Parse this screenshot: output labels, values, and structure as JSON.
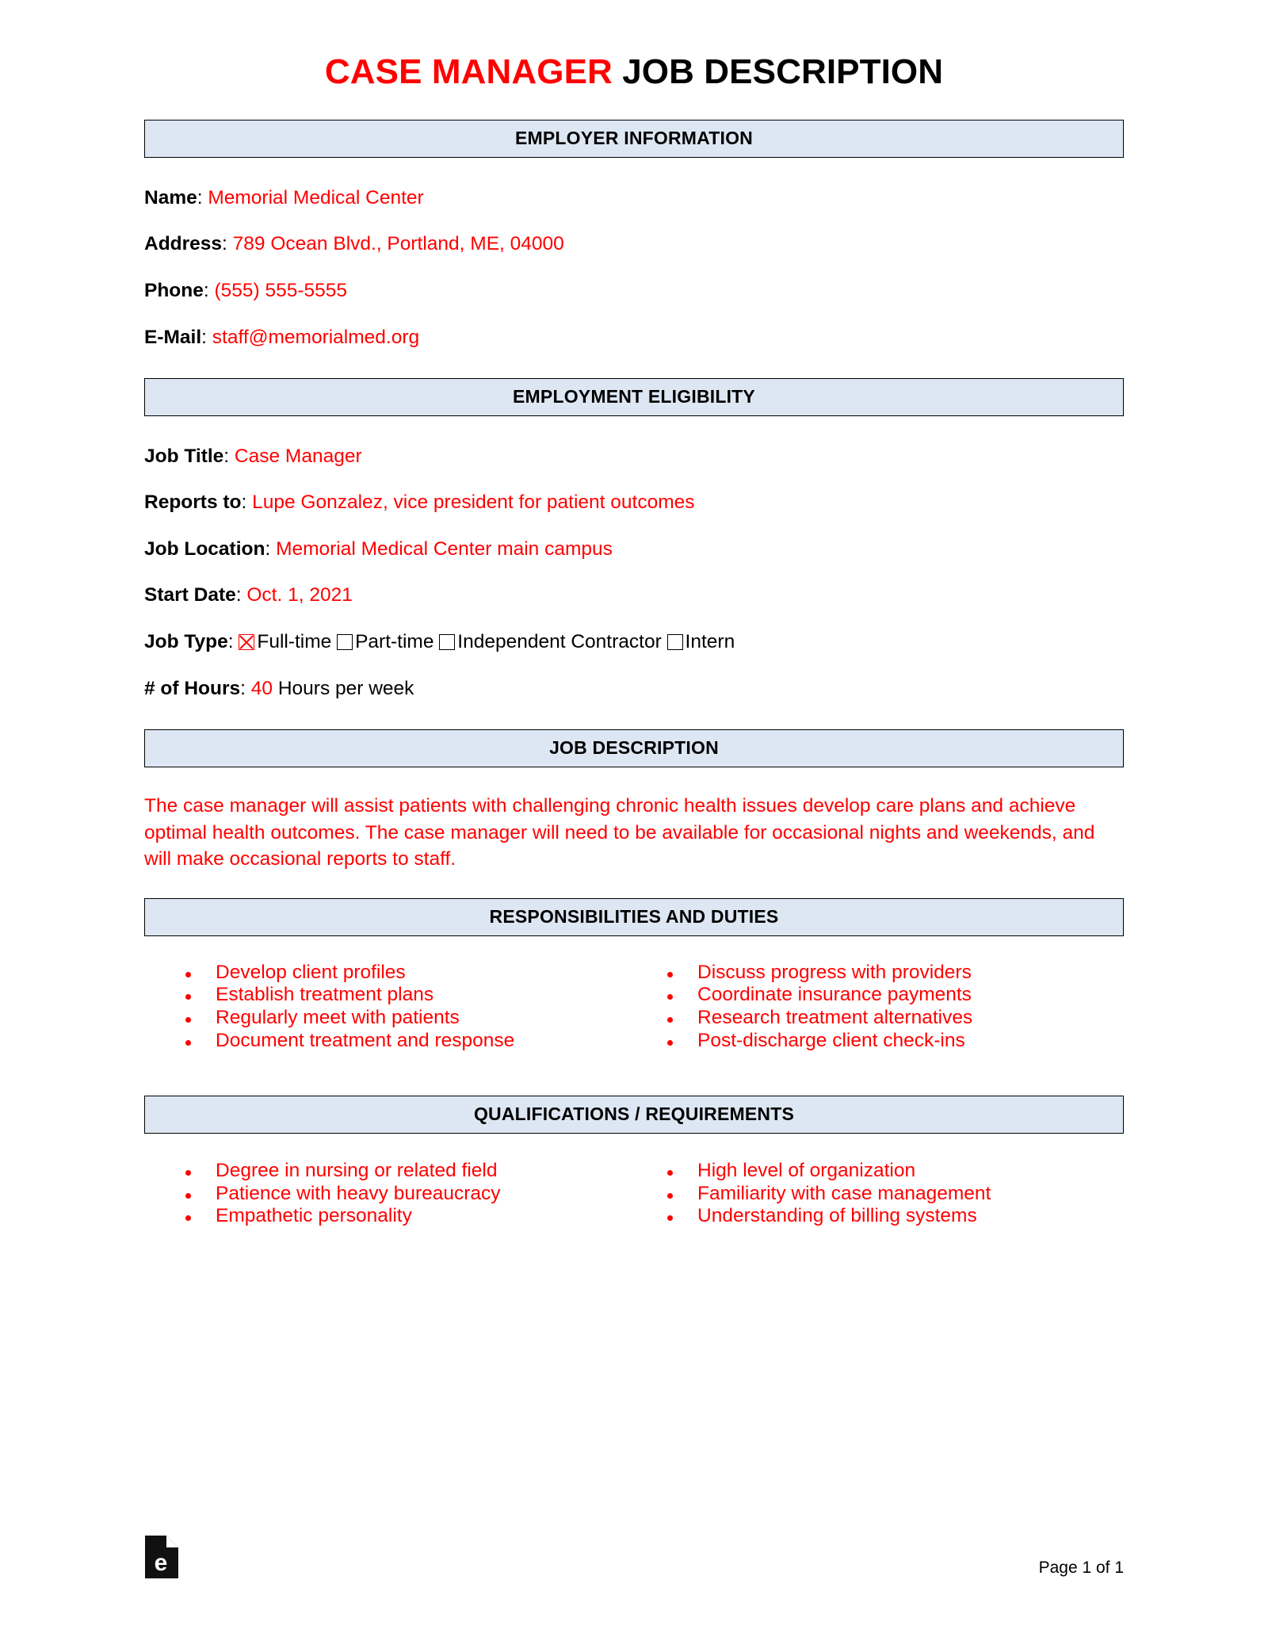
{
  "title": {
    "accent": "CASE MANAGER",
    "rest": " JOB DESCRIPTION"
  },
  "sections": {
    "employer_information": "EMPLOYER INFORMATION",
    "employment_eligibility": "EMPLOYMENT ELIGIBILITY",
    "job_description": "JOB DESCRIPTION",
    "responsibilities": "RESPONSIBILITIES AND DUTIES",
    "qualifications": "QUALIFICATIONS / REQUIREMENTS"
  },
  "employer": {
    "name_label": "Name",
    "name_value": "Memorial Medical Center",
    "address_label": "Address",
    "address_value": "789 Ocean Blvd., Portland, ME, 04000",
    "phone_label": "Phone",
    "phone_value": "(555) 555-5555",
    "email_label": "E-Mail",
    "email_value": "staff@memorialmed.org"
  },
  "eligibility": {
    "job_title_label": "Job Title",
    "job_title_value": "Case Manager",
    "reports_to_label": "Reports to",
    "reports_to_value": "Lupe Gonzalez, vice president for patient outcomes",
    "job_location_label": "Job Location",
    "job_location_value": "Memorial Medical Center main campus",
    "start_date_label": "Start Date",
    "start_date_value": "Oct. 1, 2021",
    "job_type_label": "Job Type",
    "job_type_options": [
      {
        "label": "Full-time",
        "checked": true
      },
      {
        "label": "Part-time",
        "checked": false
      },
      {
        "label": "Independent Contractor",
        "checked": false
      },
      {
        "label": "Intern",
        "checked": false
      }
    ],
    "hours_label": "# of Hours",
    "hours_value": "40",
    "hours_suffix": "Hours per week"
  },
  "description": {
    "text": "The case manager will assist patients with challenging chronic health issues develop care plans and achieve optimal health outcomes. The case manager will need to be available for occasional nights and weekends, and will make occasional reports to staff."
  },
  "responsibilities": {
    "left": [
      "Develop client profiles",
      "Establish treatment plans",
      "Regularly meet with patients",
      "Document treatment and response"
    ],
    "right": [
      "Discuss progress with providers",
      "Coordinate insurance payments",
      "Research treatment alternatives",
      "Post-discharge client check-ins"
    ]
  },
  "qualifications": {
    "left": [
      "Degree in nursing or related field",
      "Patience with heavy bureaucracy",
      "Empathetic personality"
    ],
    "right": [
      "High level of organization",
      "Familiarity with case management",
      "Understanding of billing systems"
    ]
  },
  "footer": {
    "logo_letter": "e",
    "page_number": "Page 1 of 1"
  },
  "colors": {
    "accent_red": "#ff0000",
    "header_fill": "#dde7f3",
    "text_black": "#000000"
  }
}
